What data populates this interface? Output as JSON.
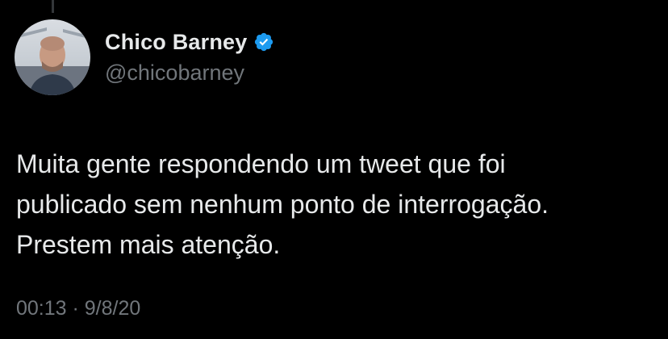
{
  "tweet": {
    "author": {
      "display_name": "Chico Barney",
      "handle": "@chicobarney",
      "verified": true,
      "verified_color": "#1d9bf0"
    },
    "text_lines": [
      "Muita gente respondendo um tweet que foi",
      "publicado sem nenhum ponto de interrogação.",
      "Prestem mais atenção."
    ],
    "timestamp": "00:13 · 9/8/20"
  },
  "colors": {
    "background": "#000000",
    "text_primary": "#e7e9ea",
    "text_secondary": "#71767b"
  }
}
